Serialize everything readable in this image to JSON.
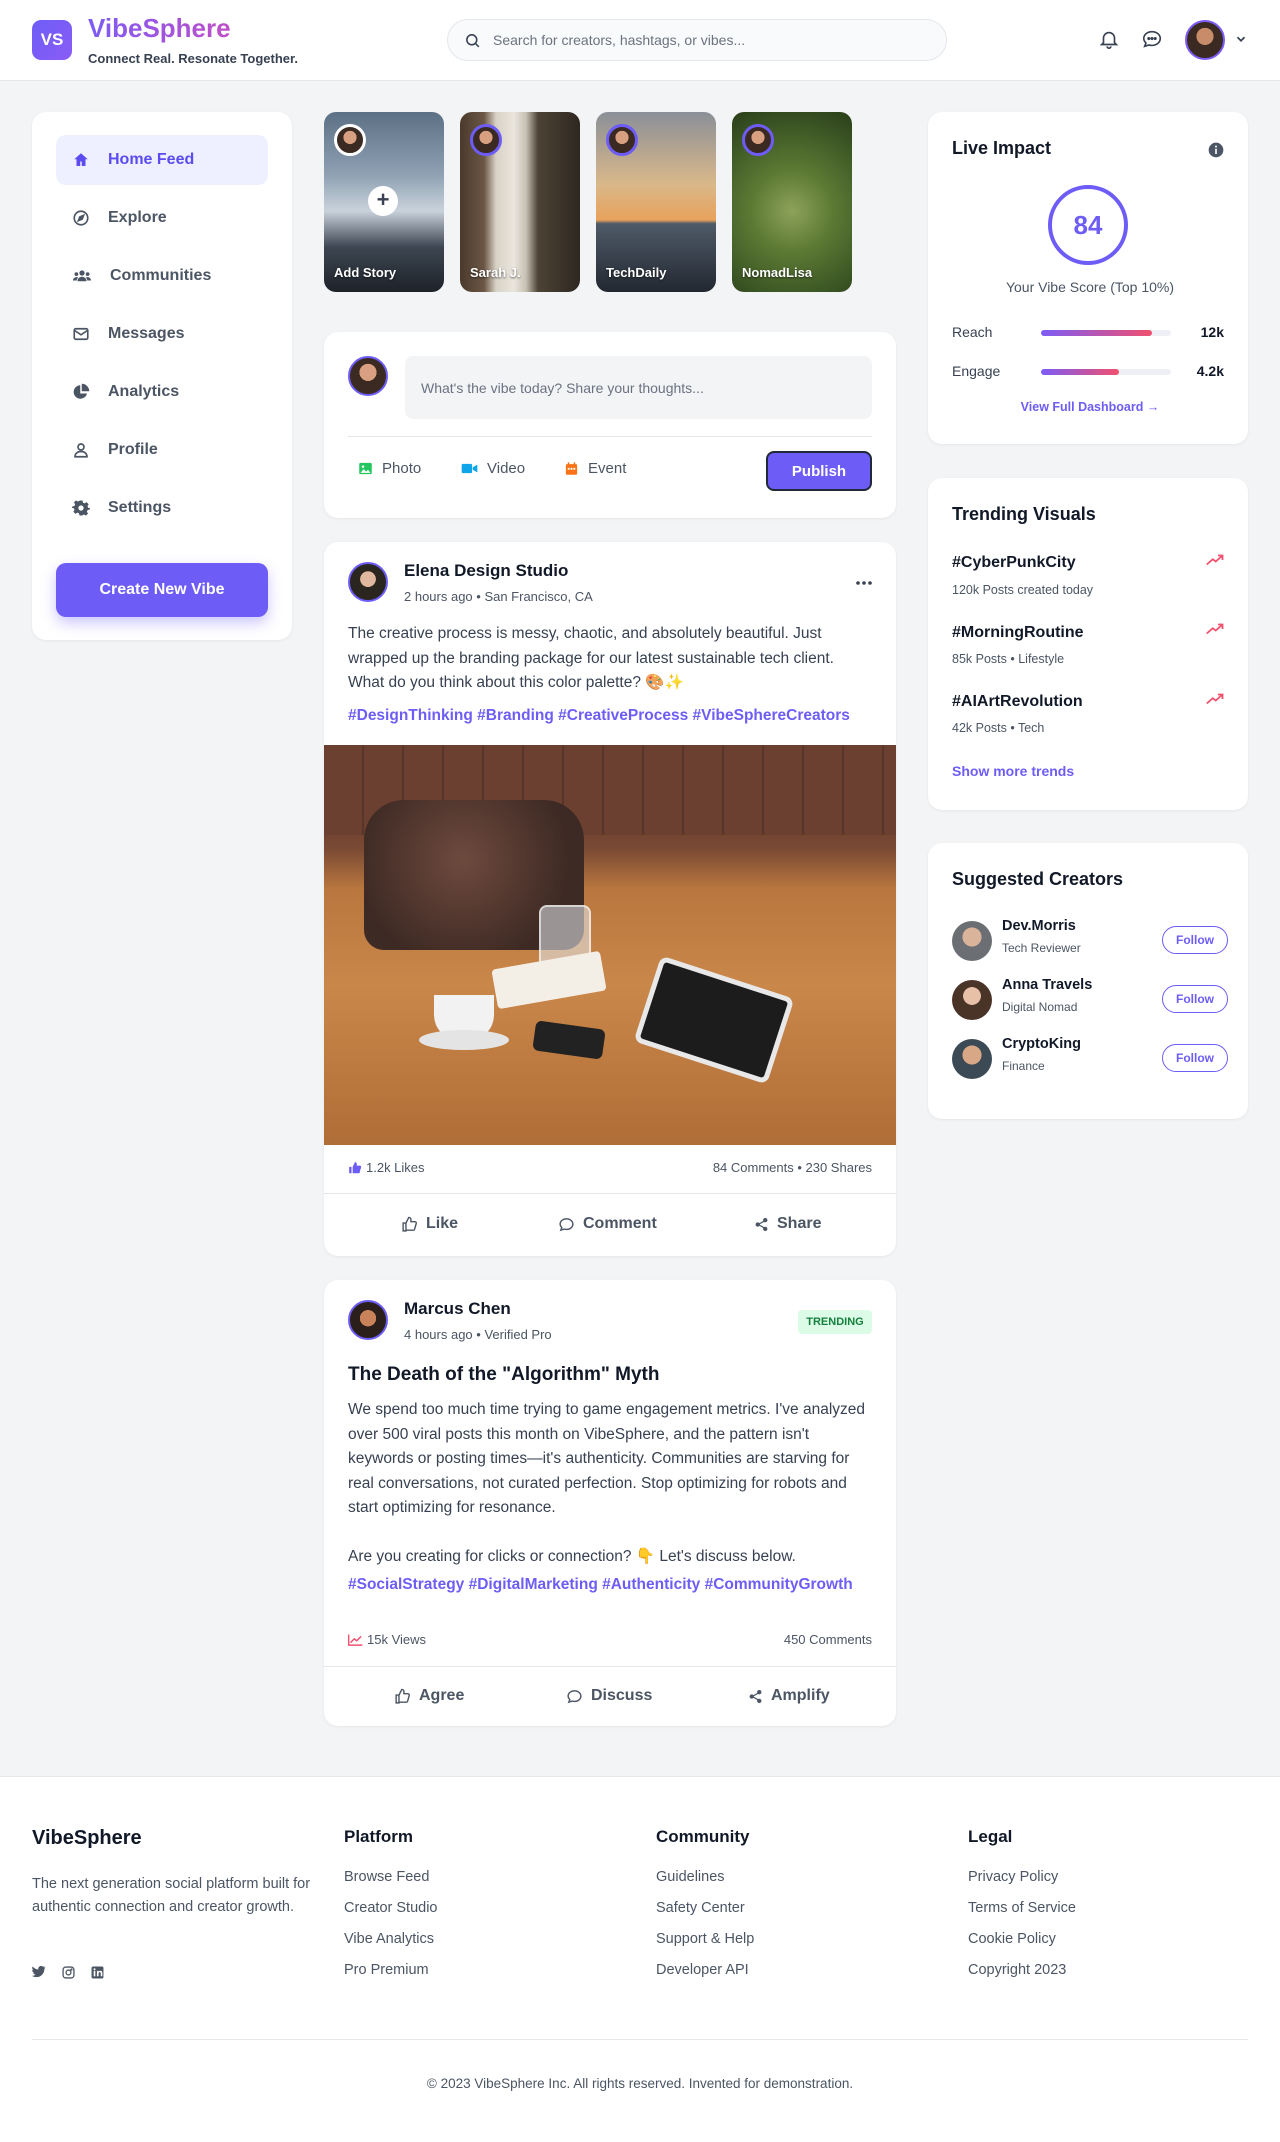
{
  "header": {
    "logo_badge": "VS",
    "brand": "VibeSphere",
    "tagline": "Connect Real. Resonate Together.",
    "search_placeholder": "Search for creators, hashtags, or vibes..."
  },
  "sidebar": {
    "items": [
      {
        "label": "Home Feed",
        "icon": "home-icon",
        "active": true
      },
      {
        "label": "Explore",
        "icon": "compass-icon"
      },
      {
        "label": "Communities",
        "icon": "users-icon"
      },
      {
        "label": "Messages",
        "icon": "envelope-icon"
      },
      {
        "label": "Analytics",
        "icon": "pie-chart-icon"
      },
      {
        "label": "Profile",
        "icon": "user-icon"
      },
      {
        "label": "Settings",
        "icon": "gear-icon"
      }
    ],
    "create_label": "Create New Vibe"
  },
  "stories": [
    {
      "name": "Add Story"
    },
    {
      "name": "Sarah J."
    },
    {
      "name": "TechDaily"
    },
    {
      "name": "NomadLisa"
    }
  ],
  "composer": {
    "placeholder": "What's the vibe today? Share your thoughts...",
    "photo": "Photo",
    "video": "Video",
    "event": "Event",
    "publish": "Publish"
  },
  "posts": [
    {
      "author": "Elena Design Studio",
      "meta": "2 hours ago • San Francisco, CA",
      "text": "The creative process is messy, chaotic, and absolutely beautiful. Just wrapped up the branding package for our latest sustainable tech client. What do you think about this color palette? 🎨✨",
      "tags": "#DesignThinking #Branding #CreativeProcess #VibeSphereCreators",
      "likes": "1.2k Likes",
      "comments_shares": "84 Comments • 230 Shares",
      "actions": [
        "Like",
        "Comment",
        "Share"
      ]
    },
    {
      "author": "Marcus Chen",
      "meta": "4 hours ago • Verified Pro",
      "badge": "TRENDING",
      "title": "The Death of the \"Algorithm\" Myth",
      "text": "We spend too much time trying to game engagement metrics. I've analyzed over 500 viral posts this month on VibeSphere, and the pattern isn't keywords or posting times—it's authenticity. Communities are starving for real conversations, not curated perfection. Stop optimizing for robots and start optimizing for resonance.",
      "text2": "Are you creating for clicks or connection? 👇 Let's discuss below.",
      "tags": "#SocialStrategy #DigitalMarketing #Authenticity #CommunityGrowth",
      "views": "15k Views",
      "comments": "450 Comments",
      "actions": [
        "Agree",
        "Discuss",
        "Amplify"
      ]
    }
  ],
  "impact": {
    "title": "Live Impact",
    "score": "84",
    "caption": "Your Vibe Score (Top 10%)",
    "metrics": [
      {
        "label": "Reach",
        "value": "12k",
        "level": 0.85
      },
      {
        "label": "Engage",
        "value": "4.2k",
        "level": 0.6
      }
    ],
    "link": "View Full Dashboard →"
  },
  "trending": {
    "title": "Trending Visuals",
    "items": [
      {
        "tag": "#CyberPunkCity",
        "sub": "120k Posts created today"
      },
      {
        "tag": "#MorningRoutine",
        "sub": "85k Posts • Lifestyle"
      },
      {
        "tag": "#AIArtRevolution",
        "sub": "42k Posts • Tech"
      }
    ],
    "show_more": "Show more trends"
  },
  "creators": {
    "title": "Suggested Creators",
    "follow_label": "Follow",
    "items": [
      {
        "name": "Dev.Morris",
        "role": "Tech Reviewer"
      },
      {
        "name": "Anna Travels",
        "role": "Digital Nomad"
      },
      {
        "name": "CryptoKing",
        "role": "Finance"
      }
    ]
  },
  "footer": {
    "brand": "VibeSphere",
    "desc": "The next generation social platform built for authentic connection and creator growth.",
    "columns": [
      {
        "title": "Platform",
        "links": [
          "Browse Feed",
          "Creator Studio",
          "Vibe Analytics",
          "Pro Premium"
        ]
      },
      {
        "title": "Community",
        "links": [
          "Guidelines",
          "Safety Center",
          "Support & Help",
          "Developer API"
        ]
      },
      {
        "title": "Legal",
        "links": [
          "Privacy Policy",
          "Terms of Service",
          "Cookie Policy",
          "Copyright 2023"
        ]
      }
    ],
    "copyright": "© 2023 VibeSphere Inc. All rights reserved. Invented for demonstration."
  },
  "colors": {
    "accent": "#6d5df6",
    "trend": "#f0506e",
    "badge_bg": "#dcfce7",
    "badge_text": "#15803d"
  }
}
